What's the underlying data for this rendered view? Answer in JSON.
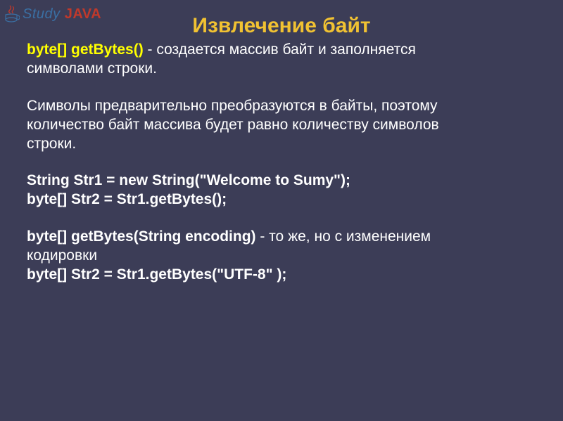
{
  "logo": {
    "study": "Study",
    "java": " JAVA"
  },
  "title": "Извлечение  байт",
  "line1": {
    "sig_type": "byte[] ",
    "sig_name": "getBytes",
    "sig_paren": "()",
    "desc1": " - создается массив байт и заполняется",
    "desc2": "символами строки."
  },
  "para2": {
    "l1": "Символы предварительно преобразуются в байты, поэтому",
    "l2": "количество байт массива будет равно количеству символов",
    "l3": "строки."
  },
  "code1": {
    "l1": "String Str1 = new String(\"Welcome to Sumy\");",
    "l2": "byte[] Str2 = Str1.getBytes();"
  },
  "line4": {
    "sig": "byte[] getBytes(String encoding)",
    "desc": " - то же, но с изменением",
    "desc2": "кодировки"
  },
  "code2": {
    "l1": "byte[] Str2 = Str1.getBytes(\"UTF-8\" );"
  }
}
